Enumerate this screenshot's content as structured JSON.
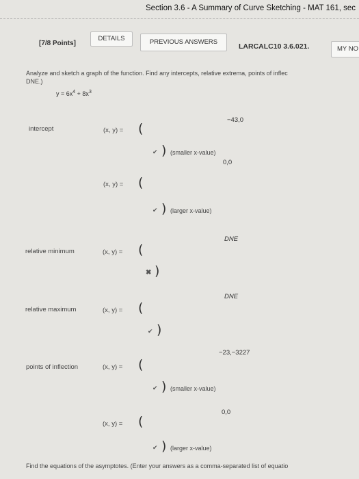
{
  "header": {
    "title": "Section 3.6 - A Summary of Curve Sketching - MAT 161, sec"
  },
  "toolbar": {
    "points": "[7/8 Points]",
    "details": "DETAILS",
    "previous_answers": "PREVIOUS ANSWERS",
    "problem_code": "LARCALC10 3.6.021.",
    "my_notes": "MY NO"
  },
  "question": {
    "instructions_line1": "Analyze and sketch a graph of the function. Find any intercepts, relative extrema, points of inflec",
    "instructions_line2": "DNE.)",
    "equation_prefix": "y = 6x",
    "equation_exp1": "4",
    "equation_mid": " + 8x",
    "equation_exp2": "3"
  },
  "rows": {
    "intercept_label": "intercept",
    "xy_text": "(x, y) =",
    "open_paren": "(",
    "close_paren": ")",
    "intercept1_value": "−43,0",
    "intercept1_note": "(smaller x-value)",
    "intercept2_value": "0,0",
    "intercept2_note": "(larger x-value)",
    "relmin_label": "relative minimum",
    "relmin_value": "DNE",
    "relmax_label": "relative maximum",
    "relmax_value": "DNE",
    "inflection_label": "points of inflection",
    "inflection1_value": "−23,−3227",
    "inflection1_note": "(smaller x-value)",
    "inflection2_value": "0,0",
    "inflection2_note": "(larger x-value)",
    "check_mark": "✔",
    "cross_mark": "✖"
  },
  "footer": {
    "text": "Find the equations of the asymptotes. (Enter your answers as a comma-separated list of equatio"
  }
}
